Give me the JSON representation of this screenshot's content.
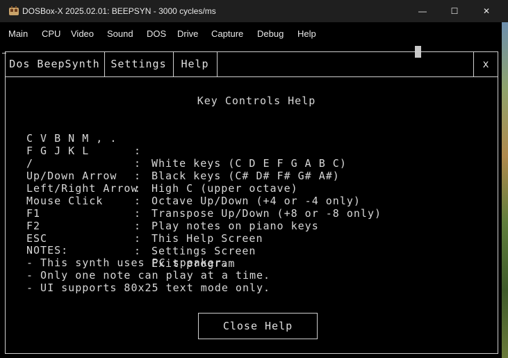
{
  "window": {
    "title": "DOSBox-X 2025.02.01: BEEPSYN - 3000 cycles/ms",
    "controls": {
      "minimize": "—",
      "maximize": "☐",
      "close": "✕"
    }
  },
  "menubar": {
    "items": [
      "Main",
      "CPU",
      "Video",
      "Sound",
      "DOS",
      "Drive",
      "Capture",
      "Debug",
      "Help"
    ]
  },
  "app": {
    "tabs": [
      "Dos BeepSynth",
      "Settings",
      "Help"
    ],
    "close": "x",
    "heading": "Key Controls Help",
    "controls": [
      {
        "key": "C V B N M , .",
        "sep": ":",
        "desc": "White keys (C D E F G A B C)"
      },
      {
        "key": "F G J K L",
        "sep": ":",
        "desc": "Black keys (C# D# F# G# A#)"
      },
      {
        "key": "/",
        "sep": ":",
        "desc": "High C (upper octave)"
      },
      {
        "key": "Up/Down Arrow",
        "sep": ":",
        "desc": "Octave Up/Down (+4 or -4 only)"
      },
      {
        "key": "Left/Right Arrow",
        "sep": ":",
        "desc": "Transpose Up/Down (+8 or -8 only)"
      },
      {
        "key": "Mouse Click",
        "sep": ":",
        "desc": "Play notes on piano keys"
      },
      {
        "key": "F1",
        "sep": ":",
        "desc": "This Help Screen"
      },
      {
        "key": "F2",
        "sep": ":",
        "desc": "Settings Screen"
      },
      {
        "key": "ESC",
        "sep": ":",
        "desc": "Exit program"
      }
    ],
    "notes_title": "NOTES:",
    "notes": [
      "- This synth uses PC speaker.",
      "- Only one note can play at a time.",
      "- UI supports 80x25 text mode only."
    ],
    "close_button": "Close Help"
  }
}
